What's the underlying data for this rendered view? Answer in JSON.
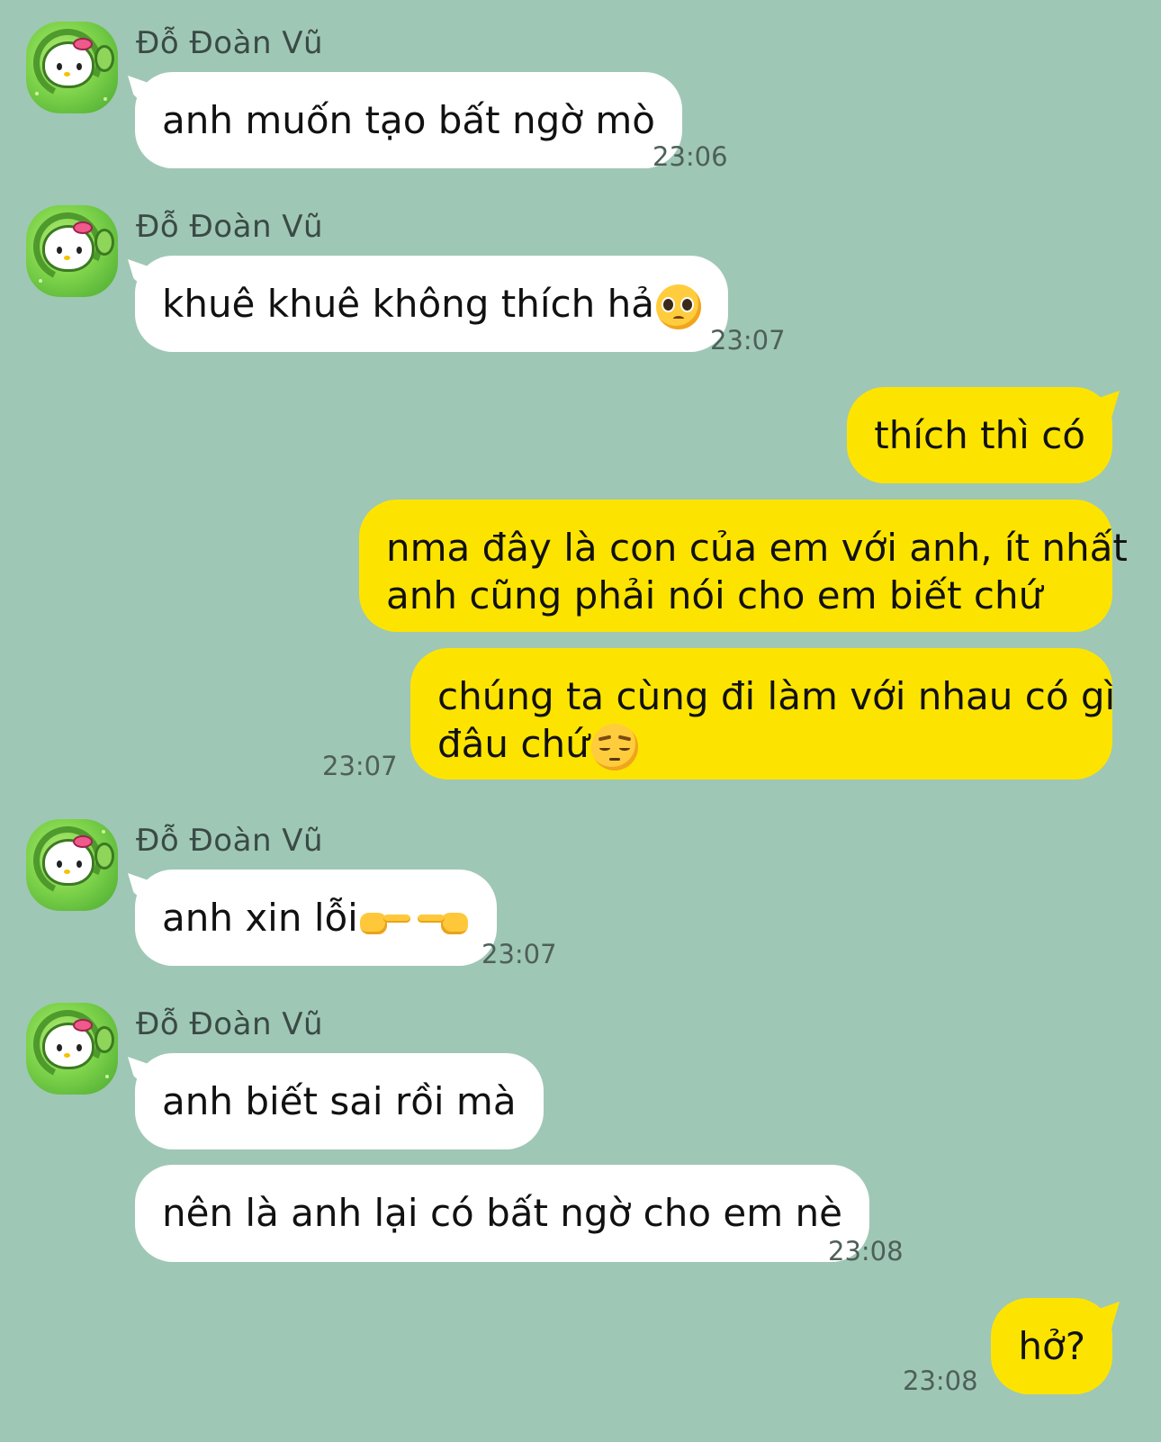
{
  "contact": {
    "name": "Đỗ Đoàn Vũ"
  },
  "messages": [
    {
      "side": "in",
      "text": "anh muốn tạo bất ngờ mò",
      "time": "23:06"
    },
    {
      "side": "in",
      "text": "khuê khuê không thích hả",
      "emoji": "pleading-face-emoji",
      "time": "23:07"
    },
    {
      "side": "out",
      "text": "thích thì có"
    },
    {
      "side": "out",
      "line1": "nma đây là con của em với anh, ít nhất",
      "line2": "anh cũng phải nói cho em biết chứ"
    },
    {
      "side": "out",
      "line1": "chúng ta cùng đi làm với nhau có gì",
      "line2": "đâu chứ",
      "emoji": "pensive-face-emoji",
      "time": "23:07"
    },
    {
      "side": "in",
      "text": "anh xin lỗi",
      "emoji": "pointing-fingers-emoji",
      "time": "23:07"
    },
    {
      "side": "in",
      "text": "anh biết sai rồi mà"
    },
    {
      "side": "in",
      "text": "nên là anh lại có bất ngờ cho em nè",
      "time": "23:08"
    },
    {
      "side": "out",
      "text": "hở?",
      "time": "23:08"
    }
  ],
  "colors": {
    "background": "#9fc7b5",
    "incoming_bubble": "#ffffff",
    "outgoing_bubble": "#fde400",
    "timestamp": "#4e5f59"
  }
}
